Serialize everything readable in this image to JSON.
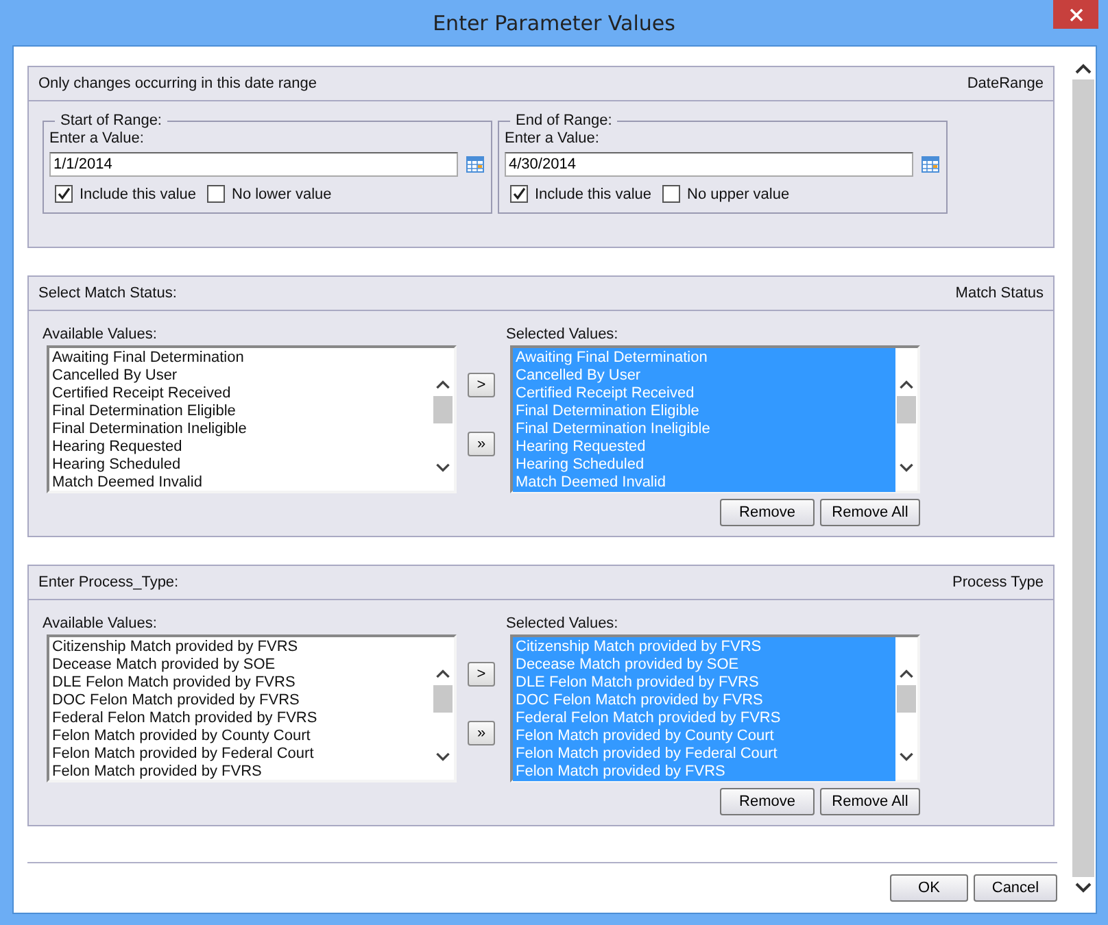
{
  "window": {
    "title": "Enter Parameter Values"
  },
  "date_range": {
    "prompt": "Only changes occurring in this date range",
    "name": "DateRange",
    "ranges": [
      {
        "legend": "Start of Range:",
        "label": "Enter a Value:",
        "value": "1/1/2014",
        "options": [
          {
            "label": "Include this value",
            "checked": true
          },
          {
            "label": "No lower value",
            "checked": false
          }
        ]
      },
      {
        "legend": "End of Range:",
        "label": "Enter a Value:",
        "value": "4/30/2014",
        "options": [
          {
            "label": "Include this value",
            "checked": true
          },
          {
            "label": "No upper value",
            "checked": false
          }
        ]
      }
    ]
  },
  "parameters": [
    {
      "prompt": "Select Match Status:",
      "name": "Match Status",
      "available": {
        "label": "Available Values:",
        "items": [
          {
            "text": "Awaiting Final Determination",
            "selected": false
          },
          {
            "text": "Cancelled By User",
            "selected": false
          },
          {
            "text": "Certified Receipt Received",
            "selected": false
          },
          {
            "text": "Final Determination Eligible",
            "selected": false
          },
          {
            "text": "Final Determination Ineligible",
            "selected": false
          },
          {
            "text": "Hearing Requested",
            "selected": false
          },
          {
            "text": "Hearing Scheduled",
            "selected": false
          },
          {
            "text": "Match Deemed Invalid",
            "selected": false
          }
        ]
      },
      "add_buttons": [
        ">",
        "»"
      ],
      "chosen": {
        "label": "Selected Values:",
        "items": [
          {
            "text": "Awaiting Final Determination",
            "selected": true
          },
          {
            "text": "Cancelled By User",
            "selected": true
          },
          {
            "text": "Certified Receipt Received",
            "selected": true
          },
          {
            "text": "Final Determination Eligible",
            "selected": true
          },
          {
            "text": "Final Determination Ineligible",
            "selected": true
          },
          {
            "text": "Hearing Requested",
            "selected": true
          },
          {
            "text": "Hearing Scheduled",
            "selected": true
          },
          {
            "text": "Match Deemed Invalid",
            "selected": true
          }
        ]
      },
      "buttons": [
        "Remove",
        "Remove All"
      ]
    },
    {
      "prompt": "Enter Process_Type:",
      "name": "Process Type",
      "available": {
        "label": "Available Values:",
        "items": [
          {
            "text": "Citizenship Match provided by FVRS",
            "selected": false
          },
          {
            "text": "Decease Match provided by SOE",
            "selected": false
          },
          {
            "text": "DLE Felon Match provided by FVRS",
            "selected": false
          },
          {
            "text": "DOC Felon Match provided by FVRS",
            "selected": false
          },
          {
            "text": "Federal Felon Match provided by FVRS",
            "selected": false
          },
          {
            "text": "Felon Match provided by County Court",
            "selected": false
          },
          {
            "text": "Felon Match provided by Federal Court",
            "selected": false
          },
          {
            "text": "Felon Match provided by FVRS",
            "selected": false
          }
        ]
      },
      "add_buttons": [
        ">",
        "»"
      ],
      "chosen": {
        "label": "Selected Values:",
        "items": [
          {
            "text": "Citizenship Match provided by FVRS",
            "selected": true
          },
          {
            "text": "Decease Match provided by SOE",
            "selected": true
          },
          {
            "text": "DLE Felon Match provided by FVRS",
            "selected": true
          },
          {
            "text": "DOC Felon Match provided by FVRS",
            "selected": true
          },
          {
            "text": "Federal Felon Match provided by FVRS",
            "selected": true
          },
          {
            "text": "Felon Match provided by County Court",
            "selected": true
          },
          {
            "text": "Felon Match provided by Federal Court",
            "selected": true
          },
          {
            "text": "Felon Match provided by FVRS",
            "selected": true
          }
        ]
      },
      "buttons": [
        "Remove",
        "Remove All"
      ]
    }
  ],
  "buttons": [
    "OK",
    "Cancel"
  ]
}
